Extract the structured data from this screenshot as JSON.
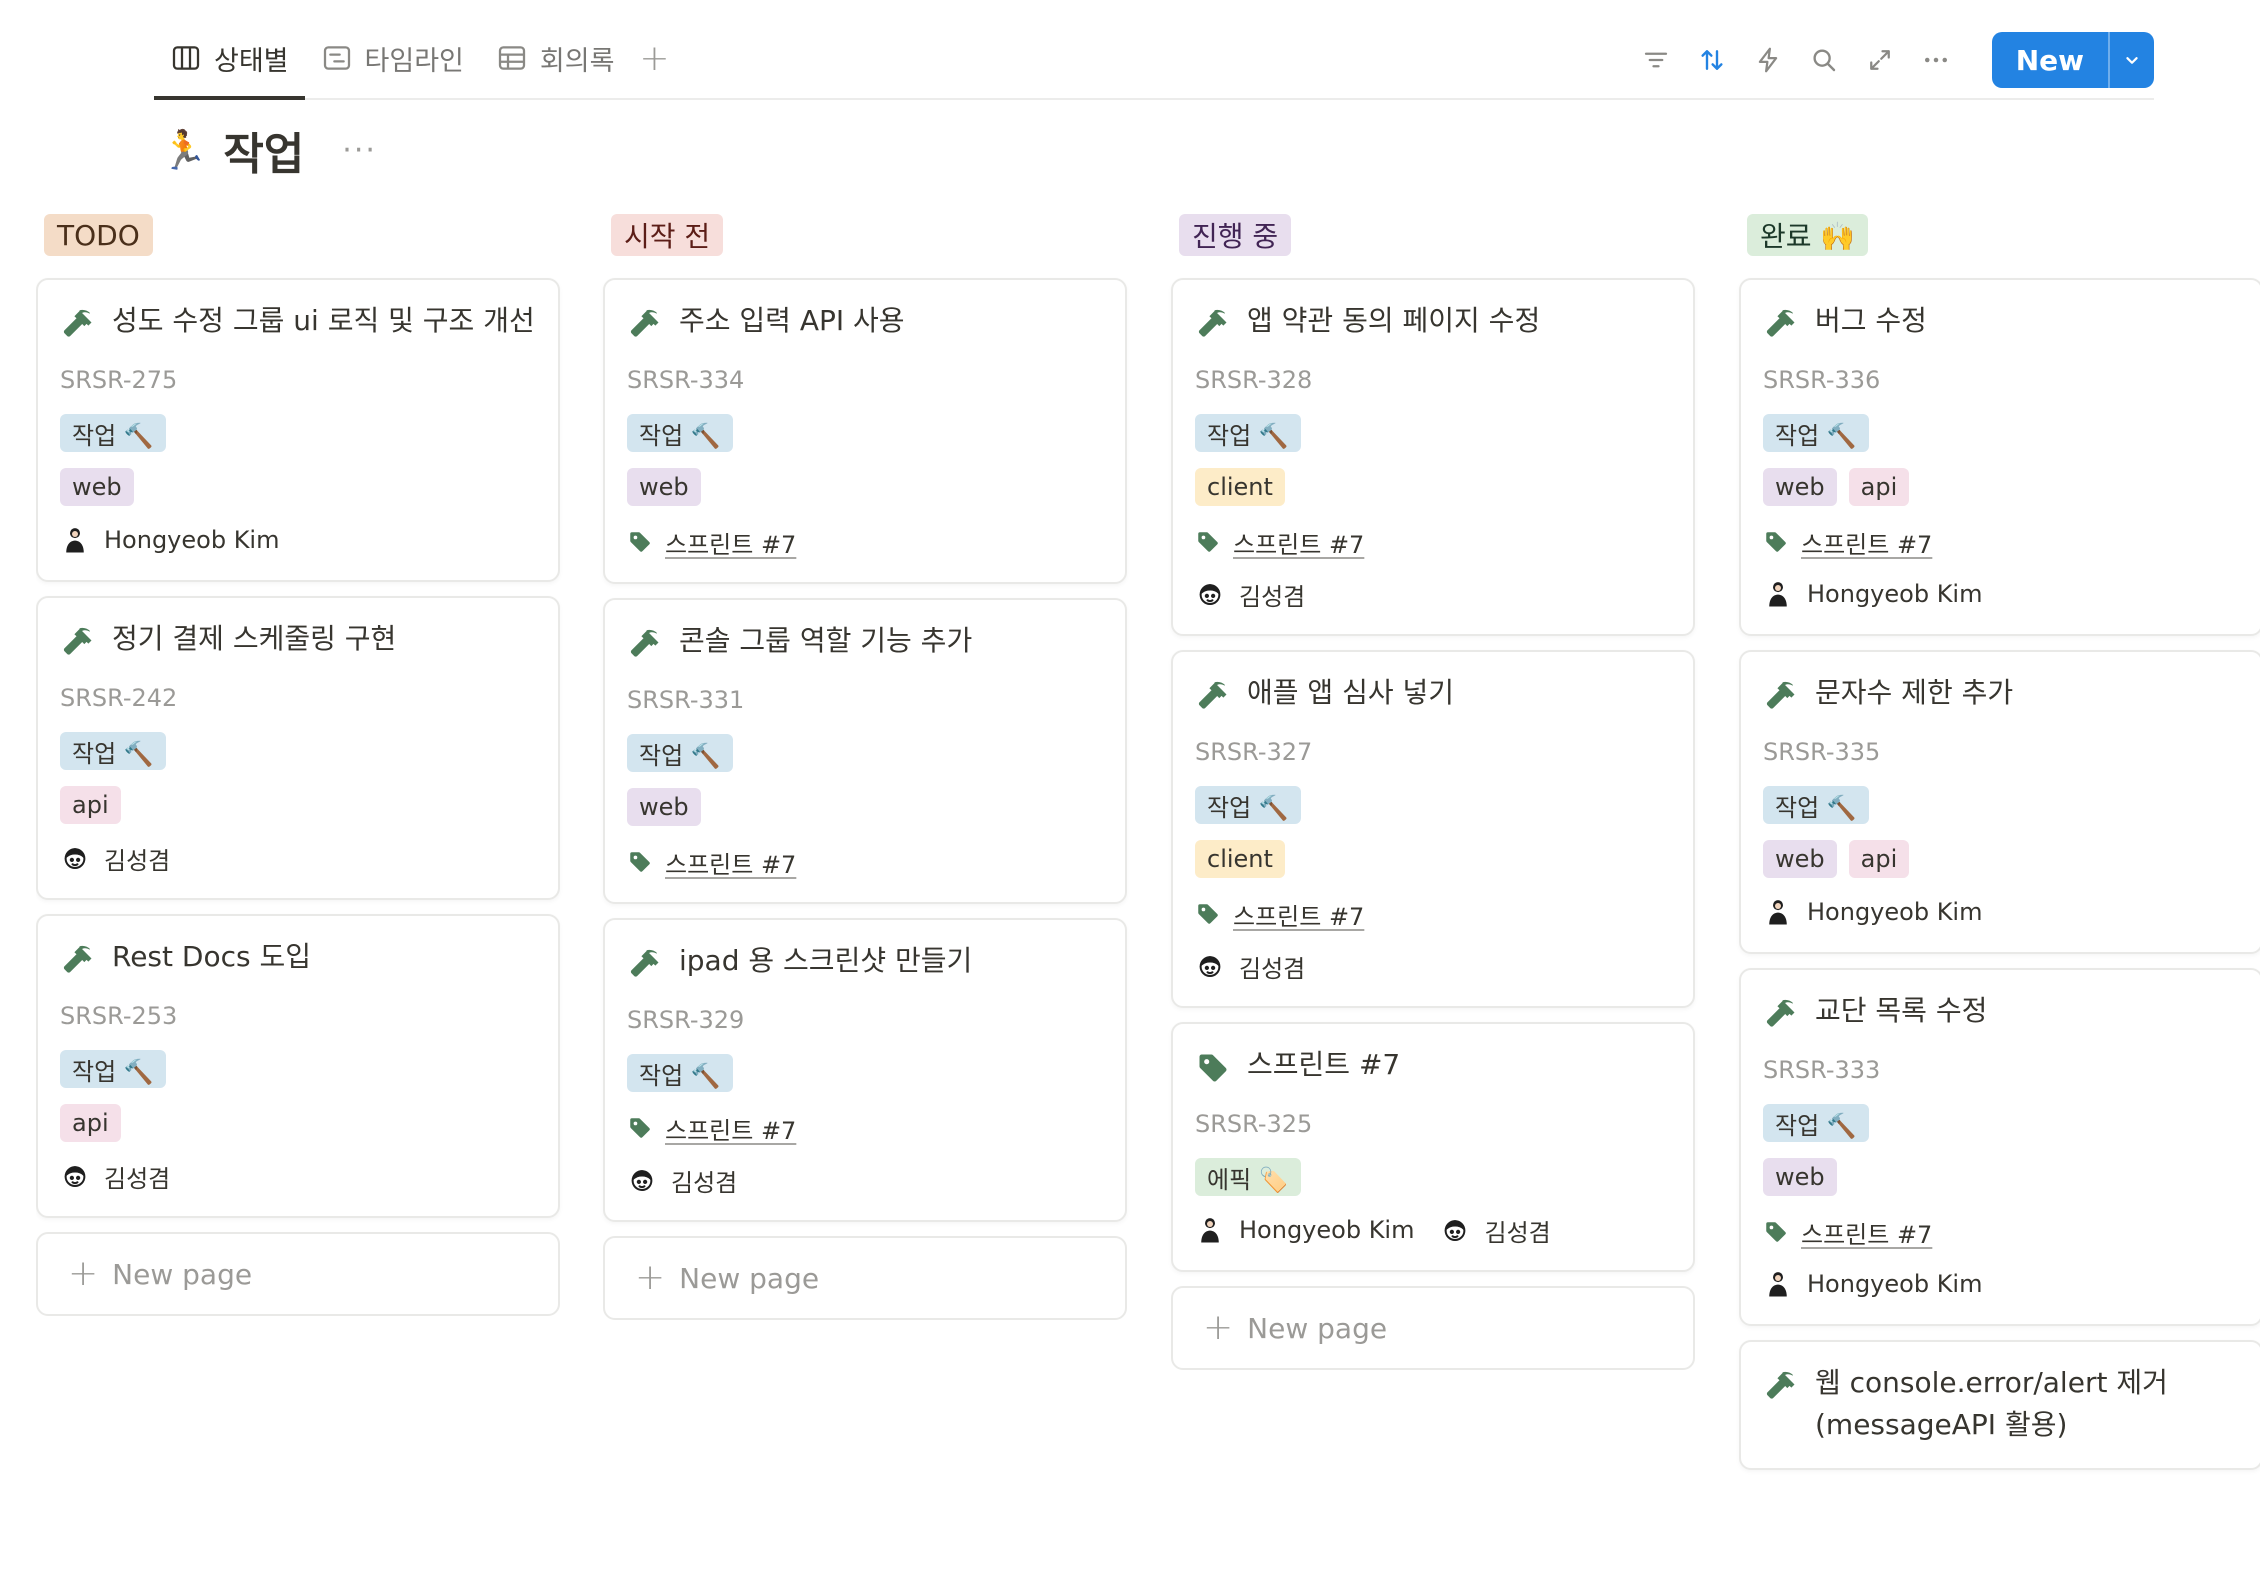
{
  "views": [
    {
      "label": "상태별",
      "icon": "board-icon",
      "active": true
    },
    {
      "label": "타임라인",
      "icon": "timeline-icon",
      "active": false
    },
    {
      "label": "회의록",
      "icon": "table-icon",
      "active": false
    }
  ],
  "toolbar": {
    "icons": [
      "filter-icon",
      "sort-icon",
      "automation-icon",
      "search-icon",
      "expand-icon",
      "more-icon"
    ],
    "new_label": "New"
  },
  "page": {
    "emoji": "🏃",
    "title": "작업",
    "more": "···"
  },
  "colors": {
    "accent": "#2383e2",
    "hammer": "#4d7c5a"
  },
  "new_page_label": "New page",
  "columns": [
    {
      "status": "TODO",
      "status_bg": "#f4dcc7",
      "status_color": "#4a2f1a",
      "cards": [
        {
          "title": "성도 수정 그룹 ui 로직 및 구조 개선",
          "id": "SRSR-275",
          "type": "작업 🔨",
          "tags": [
            {
              "label": "web",
              "kind": "web"
            }
          ],
          "relation": "",
          "people": [
            "Hongyeob Kim"
          ]
        },
        {
          "title": "정기 결제 스케줄링 구현",
          "id": "SRSR-242",
          "type": "작업 🔨",
          "tags": [
            {
              "label": "api",
              "kind": "api"
            }
          ],
          "relation": "",
          "people": [
            "김성겸"
          ]
        },
        {
          "title": "Rest Docs 도입",
          "id": "SRSR-253",
          "type": "작업 🔨",
          "tags": [
            {
              "label": "api",
              "kind": "api"
            }
          ],
          "relation": "",
          "people": [
            "김성겸"
          ]
        }
      ],
      "show_new_page": true
    },
    {
      "status": "시작 전",
      "status_bg": "#f7dedb",
      "status_color": "#5c1d17",
      "cards": [
        {
          "title": "주소 입력 API 사용",
          "id": "SRSR-334",
          "type": "작업 🔨",
          "tags": [
            {
              "label": "web",
              "kind": "web"
            }
          ],
          "relation": "스프린트 #7",
          "people": []
        },
        {
          "title": "콘솔 그룹 역할 기능 추가",
          "id": "SRSR-331",
          "type": "작업 🔨",
          "tags": [
            {
              "label": "web",
              "kind": "web"
            }
          ],
          "relation": "스프린트 #7",
          "people": []
        },
        {
          "title": "ipad 용 스크린샷 만들기",
          "id": "SRSR-329",
          "type": "작업 🔨",
          "tags": [],
          "relation": "스프린트 #7",
          "people": [
            "김성겸"
          ]
        }
      ],
      "show_new_page": true
    },
    {
      "status": "진행 중",
      "status_bg": "#e8deee",
      "status_color": "#412454",
      "cards": [
        {
          "title": "앱 약관 동의 페이지 수정",
          "id": "SRSR-328",
          "type": "작업 🔨",
          "tags": [
            {
              "label": "client",
              "kind": "client"
            }
          ],
          "relation": "스프린트 #7",
          "people": [
            "김성겸"
          ]
        },
        {
          "title": "애플 앱 심사 넣기",
          "id": "SRSR-327",
          "type": "작업 🔨",
          "tags": [
            {
              "label": "client",
              "kind": "client"
            }
          ],
          "relation": "스프린트 #7",
          "people": [
            "김성겸"
          ]
        },
        {
          "title": "스프린트 #7",
          "title_icon": "tag",
          "id": "SRSR-325",
          "type": "에픽 🏷️",
          "type_kind": "epic",
          "tags": [],
          "relation": "",
          "people": [
            "Hongyeob Kim",
            "김성겸"
          ]
        }
      ],
      "show_new_page": true
    },
    {
      "status": "완료 🙌",
      "status_bg": "#dbeddb",
      "status_color": "#1c3829",
      "cards": [
        {
          "title": "버그 수정",
          "id": "SRSR-336",
          "type": "작업 🔨",
          "tags": [
            {
              "label": "web",
              "kind": "web"
            },
            {
              "label": "api",
              "kind": "api"
            }
          ],
          "relation": "스프린트 #7",
          "people": [
            "Hongyeob Kim"
          ]
        },
        {
          "title": "문자수 제한 추가",
          "id": "SRSR-335",
          "type": "작업 🔨",
          "tags": [
            {
              "label": "web",
              "kind": "web"
            },
            {
              "label": "api",
              "kind": "api"
            }
          ],
          "relation": "",
          "people": [
            "Hongyeob Kim"
          ]
        },
        {
          "title": "교단 목록 수정",
          "id": "SRSR-333",
          "type": "작업 🔨",
          "tags": [
            {
              "label": "web",
              "kind": "web"
            }
          ],
          "relation": "스프린트 #7",
          "people": [
            "Hongyeob Kim"
          ]
        },
        {
          "title": "웹 console.error/alert 제거 (messageAPI 활용)",
          "id": "",
          "type": "",
          "tags": [],
          "relation": "",
          "people": []
        }
      ],
      "show_new_page": false
    }
  ]
}
